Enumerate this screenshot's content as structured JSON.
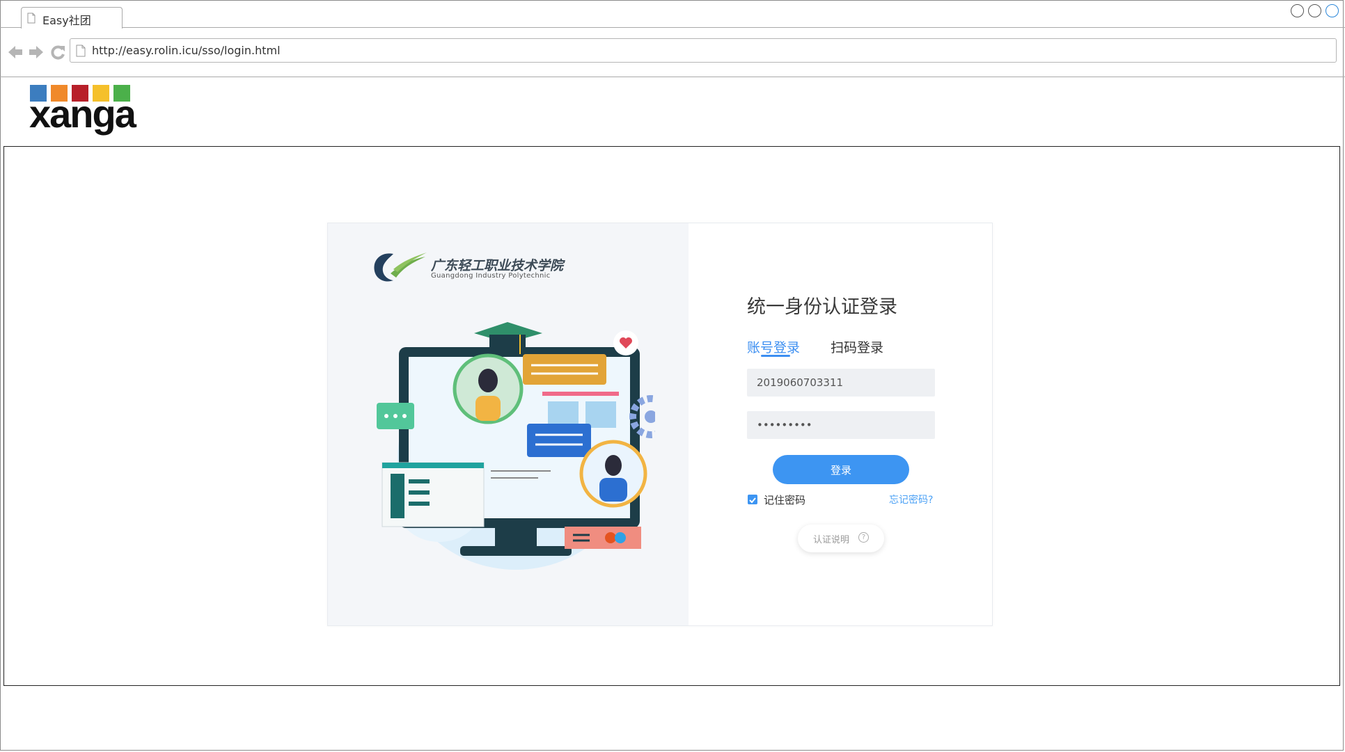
{
  "browser": {
    "tab_title": "Easy社团",
    "url": "http://easy.rolin.icu/sso/login.html"
  },
  "site_logo": {
    "text": "xanga",
    "square_colors": [
      "#3c7dbf",
      "#f0892a",
      "#b8202a",
      "#f5c02b",
      "#4bb04a"
    ]
  },
  "login_card": {
    "school_name_cn": "广东轻工职业技术学院",
    "school_name_en": "Guangdong Industry Polytechnic",
    "title": "统一身份认证登录",
    "tabs": [
      {
        "label": "账号登录",
        "active": true
      },
      {
        "label": "扫码登录",
        "active": false
      }
    ],
    "username_value": "2019060703311",
    "password_value": "•••••••••",
    "login_button": "登录",
    "remember_label": "记住密码",
    "remember_checked": true,
    "forgot_link": "忘记密码?",
    "auth_info_label": "认证说明",
    "help_symbol": "?"
  },
  "colors": {
    "accent": "#3d95f2",
    "active_tab": "#3d8ff1"
  }
}
